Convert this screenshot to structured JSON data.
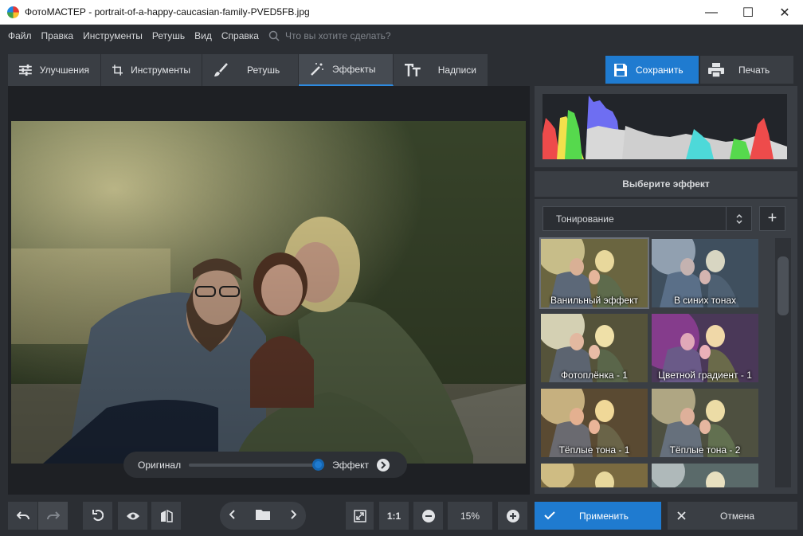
{
  "window": {
    "app_name": "ФотоМАСТЕР",
    "title": "ФотоМАСТЕР - portrait-of-a-happy-caucasian-family-PVED5FB.jpg"
  },
  "menu": {
    "items": [
      "Файл",
      "Правка",
      "Инструменты",
      "Ретушь",
      "Вид",
      "Справка"
    ],
    "search_placeholder": "Что вы хотите сделать?"
  },
  "tabs": [
    {
      "label": "Улучшения",
      "icon": "sliders-icon"
    },
    {
      "label": "Инструменты",
      "icon": "crop-icon"
    },
    {
      "label": "Ретушь",
      "icon": "brush-icon"
    },
    {
      "label": "Эффекты",
      "icon": "magic-wand-icon"
    },
    {
      "label": "Надписи",
      "icon": "text-icon"
    }
  ],
  "actions": {
    "save": "Сохранить",
    "print": "Печать"
  },
  "compare": {
    "left": "Оригинал",
    "right": "Эффект",
    "value": 1.0
  },
  "effects": {
    "header": "Выберите эффект",
    "category": "Тонирование",
    "thumbnails": [
      "Ванильный эффект",
      "В синих тонах",
      "Фотоплёнка - 1",
      "Цветной градиент - 1",
      "Тёплые тона - 1",
      "Тёплые тона - 2"
    ],
    "selected": "Ванильный эффект"
  },
  "bottom": {
    "ratio": "1:1",
    "zoom": "15%",
    "apply": "Применить",
    "cancel": "Отмена"
  },
  "colors": {
    "accent": "#1f7bd0",
    "panel": "#3a3e44",
    "background": "#2b2e33"
  }
}
